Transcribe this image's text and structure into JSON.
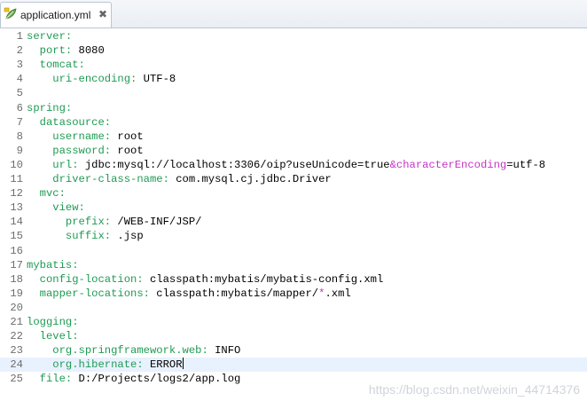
{
  "tab": {
    "title": "application.yml",
    "close_glyph": "✖",
    "icon": "yaml-file-icon"
  },
  "editor": {
    "lines": [
      {
        "num": "1",
        "parts": [
          {
            "t": "server:",
            "c": "k"
          }
        ]
      },
      {
        "num": "2",
        "parts": [
          {
            "t": "  port: ",
            "c": "k"
          },
          {
            "t": "8080",
            "c": "v"
          }
        ]
      },
      {
        "num": "3",
        "parts": [
          {
            "t": "  tomcat:",
            "c": "k"
          }
        ]
      },
      {
        "num": "4",
        "parts": [
          {
            "t": "    uri-encoding: ",
            "c": "k"
          },
          {
            "t": "UTF-8",
            "c": "v"
          }
        ]
      },
      {
        "num": "5",
        "parts": []
      },
      {
        "num": "6",
        "parts": [
          {
            "t": "spring:",
            "c": "k"
          }
        ]
      },
      {
        "num": "7",
        "parts": [
          {
            "t": "  datasource:",
            "c": "k"
          }
        ]
      },
      {
        "num": "8",
        "parts": [
          {
            "t": "    username: ",
            "c": "k"
          },
          {
            "t": "root",
            "c": "v"
          }
        ]
      },
      {
        "num": "9",
        "parts": [
          {
            "t": "    password: ",
            "c": "k"
          },
          {
            "t": "root",
            "c": "v"
          }
        ]
      },
      {
        "num": "10",
        "parts": [
          {
            "t": "    url: ",
            "c": "k"
          },
          {
            "t": "jdbc:mysql://localhost:3306/oip?useUnicode=true",
            "c": "v"
          },
          {
            "t": "&characterEncoding",
            "c": "p"
          },
          {
            "t": "=utf-8",
            "c": "v"
          }
        ]
      },
      {
        "num": "11",
        "parts": [
          {
            "t": "    driver-class-name: ",
            "c": "k"
          },
          {
            "t": "com.mysql.cj.jdbc.Driver",
            "c": "v"
          }
        ]
      },
      {
        "num": "12",
        "parts": [
          {
            "t": "  mvc:",
            "c": "k"
          }
        ]
      },
      {
        "num": "13",
        "parts": [
          {
            "t": "    view:",
            "c": "k"
          }
        ]
      },
      {
        "num": "14",
        "parts": [
          {
            "t": "      prefix: ",
            "c": "k"
          },
          {
            "t": "/WEB-INF/JSP/",
            "c": "v"
          }
        ]
      },
      {
        "num": "15",
        "parts": [
          {
            "t": "      suffix: ",
            "c": "k"
          },
          {
            "t": ".jsp",
            "c": "v"
          }
        ]
      },
      {
        "num": "16",
        "parts": []
      },
      {
        "num": "17",
        "parts": [
          {
            "t": "mybatis:",
            "c": "k"
          }
        ]
      },
      {
        "num": "18",
        "parts": [
          {
            "t": "  config-location: ",
            "c": "k"
          },
          {
            "t": "classpath:mybatis/mybatis-config.xml",
            "c": "v"
          }
        ]
      },
      {
        "num": "19",
        "parts": [
          {
            "t": "  mapper-locations: ",
            "c": "k"
          },
          {
            "t": "classpath:mybatis/mapper/",
            "c": "v"
          },
          {
            "t": "*",
            "c": "p"
          },
          {
            "t": ".xml",
            "c": "v"
          }
        ]
      },
      {
        "num": "20",
        "parts": []
      },
      {
        "num": "21",
        "parts": [
          {
            "t": "logging:",
            "c": "k"
          }
        ]
      },
      {
        "num": "22",
        "parts": [
          {
            "t": "  level:",
            "c": "k"
          }
        ]
      },
      {
        "num": "23",
        "parts": [
          {
            "t": "    org.springframework.web: ",
            "c": "k"
          },
          {
            "t": "INFO",
            "c": "v"
          }
        ]
      },
      {
        "num": "24",
        "parts": [
          {
            "t": "    org.hibernate: ",
            "c": "k"
          },
          {
            "t": "ERROR",
            "c": "v"
          }
        ],
        "current": true
      },
      {
        "num": "25",
        "parts": [
          {
            "t": "  file: ",
            "c": "k"
          },
          {
            "t": "D:/Projects/logs2/app.log",
            "c": "v"
          }
        ]
      }
    ],
    "colors": {
      "key": "#1f9b53",
      "value": "#000000",
      "special": "#c832c8",
      "current_line": "#e8f2fe"
    }
  },
  "watermark": "https://blog.csdn.net/weixin_44714376"
}
